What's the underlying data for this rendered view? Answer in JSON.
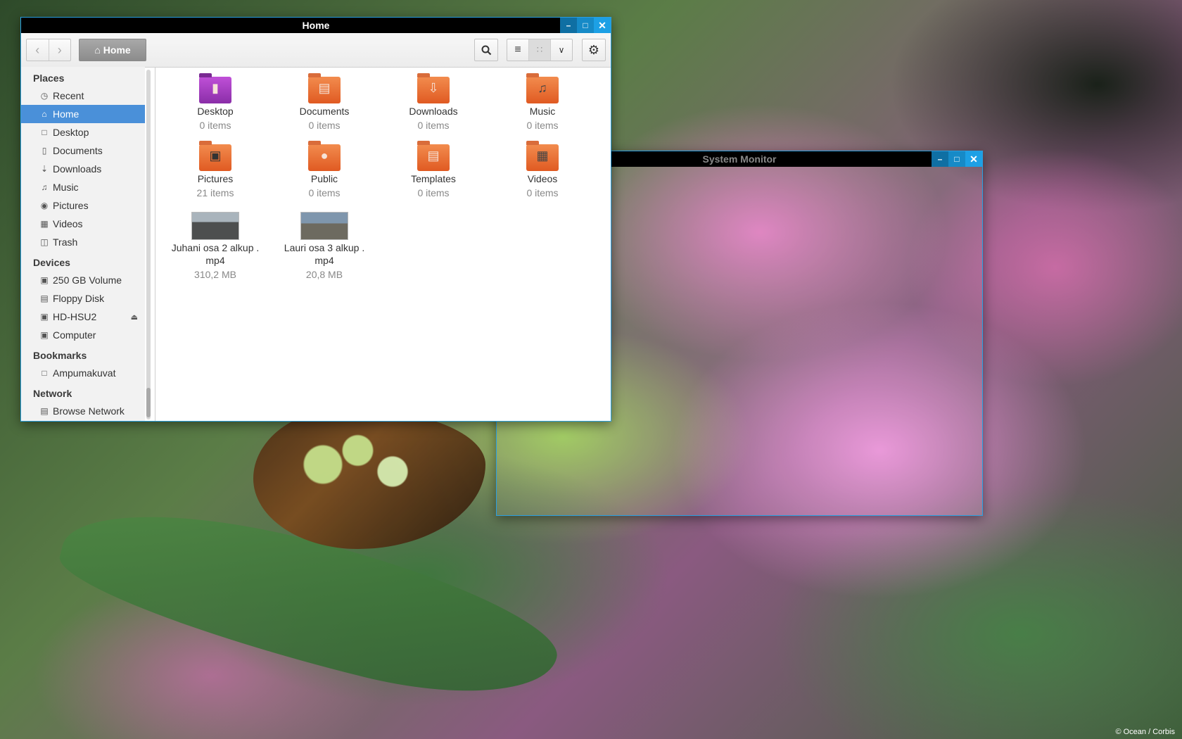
{
  "desktop": {
    "credit": "© Ocean / Corbis"
  },
  "file_manager": {
    "title": "Home",
    "toolbar": {
      "back_icon": "chevron-left-icon",
      "forward_icon": "chevron-right-icon",
      "breadcrumb_label": "Home",
      "search_icon": "search-icon",
      "view_options": [
        "list-view-icon",
        "grid-view-icon",
        "chevron-down-icon"
      ],
      "settings_icon": "gear-icon"
    },
    "sidebar": {
      "places_header": "Places",
      "places": [
        {
          "label": "Recent",
          "icon": "clock-icon"
        },
        {
          "label": "Home",
          "icon": "home-icon",
          "active": true
        },
        {
          "label": "Desktop",
          "icon": "folder-icon"
        },
        {
          "label": "Documents",
          "icon": "document-icon"
        },
        {
          "label": "Downloads",
          "icon": "download-icon"
        },
        {
          "label": "Music",
          "icon": "music-icon"
        },
        {
          "label": "Pictures",
          "icon": "camera-icon"
        },
        {
          "label": "Videos",
          "icon": "film-icon"
        },
        {
          "label": "Trash",
          "icon": "trash-icon"
        }
      ],
      "devices_header": "Devices",
      "devices": [
        {
          "label": "250 GB Volume",
          "icon": "drive-icon"
        },
        {
          "label": "Floppy Disk",
          "icon": "floppy-icon"
        },
        {
          "label": "HD-HSU2",
          "icon": "drive-icon",
          "eject": true
        },
        {
          "label": "Computer",
          "icon": "drive-icon"
        }
      ],
      "bookmarks_header": "Bookmarks",
      "bookmarks": [
        {
          "label": "Ampumakuvat",
          "icon": "folder-icon"
        }
      ],
      "network_header": "Network",
      "network": [
        {
          "label": "Browse Network",
          "icon": "network-icon"
        }
      ]
    },
    "items": [
      {
        "name": "Desktop",
        "meta": "0 items",
        "kind": "desktop-folder"
      },
      {
        "name": "Documents",
        "meta": "0 items",
        "kind": "documents-folder"
      },
      {
        "name": "Downloads",
        "meta": "0 items",
        "kind": "downloads-folder"
      },
      {
        "name": "Music",
        "meta": "0 items",
        "kind": "music-folder"
      },
      {
        "name": "Pictures",
        "meta": "21 items",
        "kind": "pictures-folder"
      },
      {
        "name": "Public",
        "meta": "0 items",
        "kind": "public-folder"
      },
      {
        "name": "Templates",
        "meta": "0 items",
        "kind": "templates-folder"
      },
      {
        "name": "Videos",
        "meta": "0 items",
        "kind": "videos-folder"
      },
      {
        "name": "Juhani osa 2 alkup .\nmp4",
        "name_line1": "Juhani osa 2 alkup .",
        "name_line2": "mp4",
        "meta": "310,2 MB",
        "kind": "video-file"
      },
      {
        "name": "Lauri osa 3 alkup .\nmp4",
        "name_line1": "Lauri osa 3 alkup .",
        "name_line2": "mp4",
        "meta": "20,8 MB",
        "kind": "video-file"
      }
    ]
  },
  "system_monitor": {
    "title": "System Monitor"
  }
}
